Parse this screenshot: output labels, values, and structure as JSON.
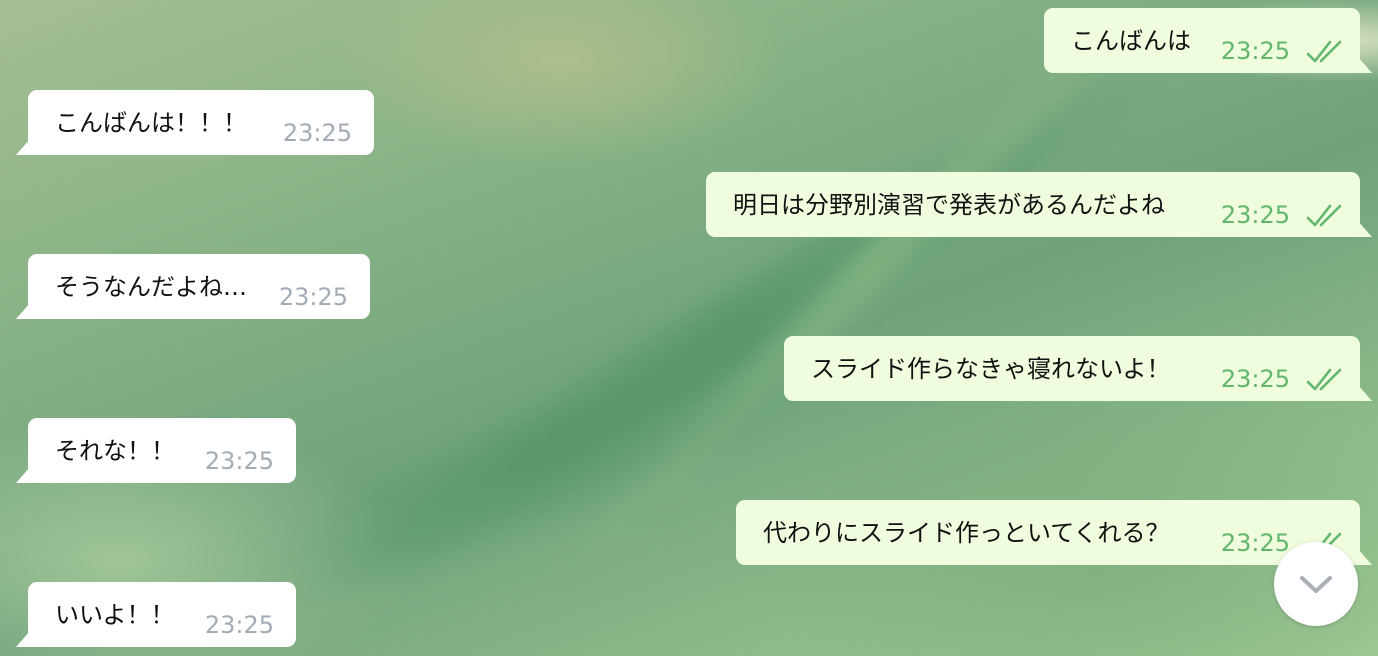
{
  "messages": [
    {
      "side": "out",
      "text": "こんばんは",
      "time": "23:25",
      "read_icon": "double-check-icon"
    },
    {
      "side": "in",
      "text": "こんばんは！！！",
      "time": "23:25"
    },
    {
      "side": "out",
      "text": "明日は分野別演習で発表があるんだよね",
      "time": "23:25",
      "read_icon": "double-check-icon"
    },
    {
      "side": "in",
      "text": "そうなんだよね…",
      "time": "23:25"
    },
    {
      "side": "out",
      "text": "スライド作らなきゃ寝れないよ！",
      "time": "23:25",
      "read_icon": "double-check-icon"
    },
    {
      "side": "in",
      "text": "それな！！",
      "time": "23:25"
    },
    {
      "side": "out",
      "text": "代わりにスライド作っといてくれる？",
      "time": "23:25",
      "read_icon": "double-check-icon"
    },
    {
      "side": "in",
      "text": "いいよ！！",
      "time": "23:25"
    }
  ],
  "scroll_button": {
    "icon": "chevron-down-icon"
  },
  "colors": {
    "incoming_bubble": "#ffffff",
    "outgoing_bubble": "#effdde",
    "incoming_time": "#a3acb6",
    "outgoing_time": "#62b66b",
    "read_check": "#62b66b"
  }
}
